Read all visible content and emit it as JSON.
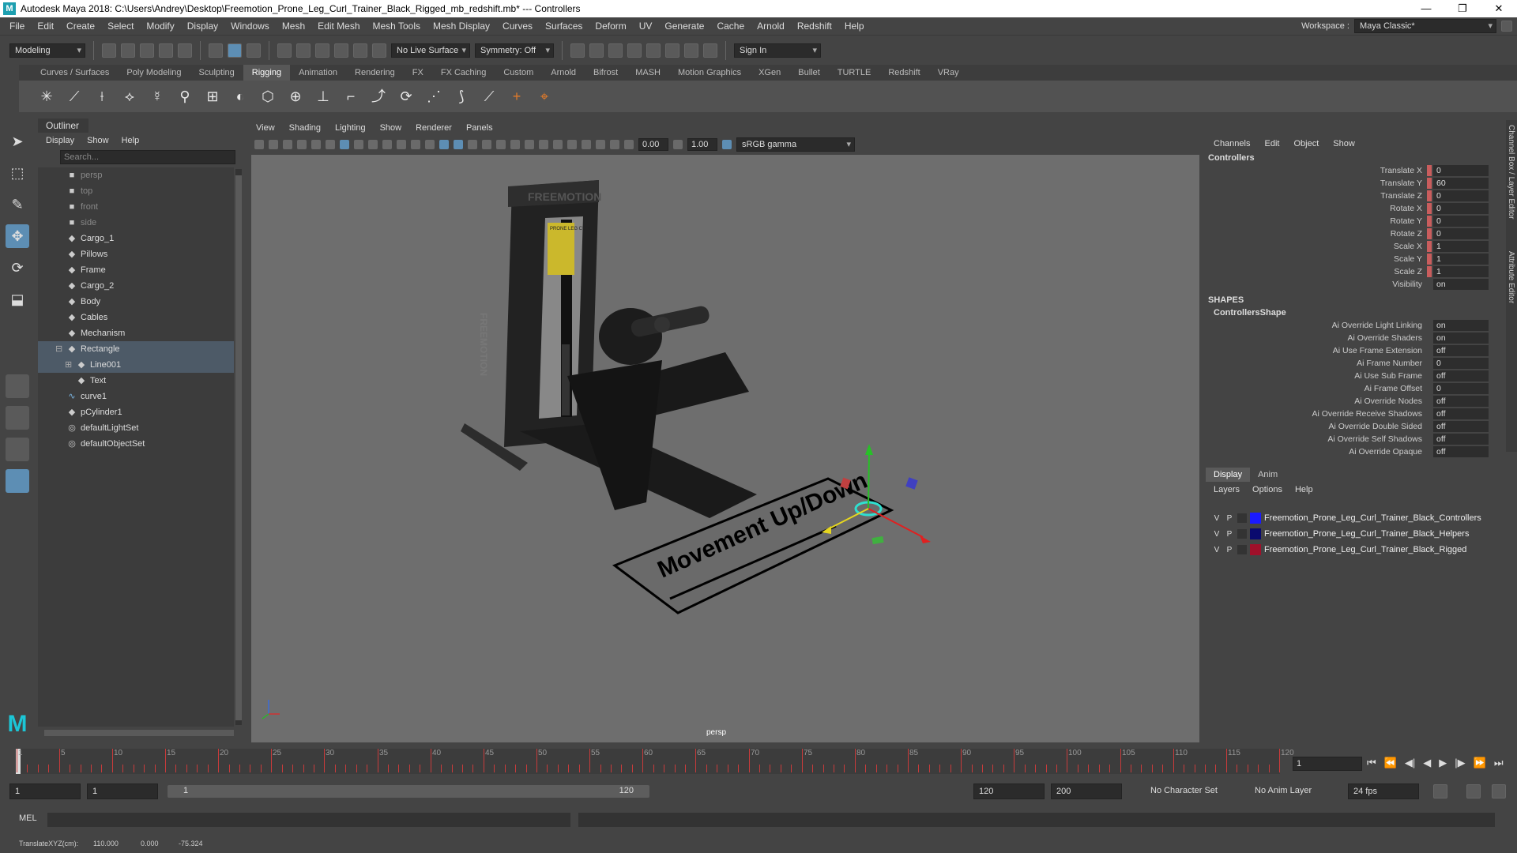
{
  "window": {
    "title": "Autodesk Maya 2018: C:\\Users\\Andrey\\Desktop\\Freemotion_Prone_Leg_Curl_Trainer_Black_Rigged_mb_redshift.mb*   ---   Controllers",
    "logo": "M",
    "min": "—",
    "max": "❐",
    "close": "✕"
  },
  "menu": [
    "File",
    "Edit",
    "Create",
    "Select",
    "Modify",
    "Display",
    "Windows",
    "Mesh",
    "Edit Mesh",
    "Mesh Tools",
    "Mesh Display",
    "Curves",
    "Surfaces",
    "Deform",
    "UV",
    "Generate",
    "Cache",
    "Arnold",
    "Redshift",
    "Help"
  ],
  "workspace": {
    "label": "Workspace :",
    "value": "Maya Classic*"
  },
  "statusline": {
    "mode": "Modeling",
    "live_surface": "No Live Surface",
    "symmetry": "Symmetry: Off",
    "sign_in": "Sign In"
  },
  "shelf_tabs": [
    "Curves / Surfaces",
    "Poly Modeling",
    "Sculpting",
    "Rigging",
    "Animation",
    "Rendering",
    "FX",
    "FX Caching",
    "Custom",
    "Arnold",
    "Bifrost",
    "MASH",
    "Motion Graphics",
    "XGen",
    "Bullet",
    "TURTLE",
    "Redshift",
    "VRay"
  ],
  "shelf_active": "Rigging",
  "shelf_icons": [
    "✳",
    "⟋",
    "⟊",
    "⟡",
    "☿",
    "⚲",
    "⊞",
    "◐",
    "⬡",
    "⊕",
    "⊥",
    "⌐",
    "⤴",
    "⟳",
    "⋰",
    "⟆",
    "⟋",
    "+",
    "⌖"
  ],
  "toolbox": [
    "➤",
    "⬚",
    "✎",
    "✥",
    "⟳",
    "⬓"
  ],
  "outliner": {
    "title": "Outliner",
    "menu": [
      "Display",
      "Show",
      "Help"
    ],
    "search_placeholder": "Search...",
    "items": [
      {
        "label": "persp",
        "icon": "■",
        "dim": true
      },
      {
        "label": "top",
        "icon": "■",
        "dim": true
      },
      {
        "label": "front",
        "icon": "■",
        "dim": true
      },
      {
        "label": "side",
        "icon": "■",
        "dim": true
      },
      {
        "label": "Cargo_1",
        "icon": "◆"
      },
      {
        "label": "Pillows",
        "icon": "◆"
      },
      {
        "label": "Frame",
        "icon": "◆"
      },
      {
        "label": "Cargo_2",
        "icon": "◆"
      },
      {
        "label": "Body",
        "icon": "◆"
      },
      {
        "label": "Cables",
        "icon": "◆"
      },
      {
        "label": "Mechanism",
        "icon": "◆"
      },
      {
        "label": "Rectangle",
        "icon": "◆",
        "selected": true,
        "expander": "⊟"
      },
      {
        "label": "Line001",
        "icon": "◆",
        "selected": true,
        "child": true,
        "expander": "⊞"
      },
      {
        "label": "Text",
        "icon": "◆",
        "child": true
      },
      {
        "label": "curve1",
        "icon": "∿"
      },
      {
        "label": "pCylinder1",
        "icon": "◆"
      },
      {
        "label": "defaultLightSet",
        "icon": "◎"
      },
      {
        "label": "defaultObjectSet",
        "icon": "◎"
      }
    ]
  },
  "viewport": {
    "menu": [
      "View",
      "Shading",
      "Lighting",
      "Show",
      "Renderer",
      "Panels"
    ],
    "exposure": "0.00",
    "gamma": "1.00",
    "color_space": "sRGB gamma",
    "camera": "persp",
    "machine_brand": "FREEMOTION",
    "placard": "PRONE LEG CURL",
    "control_text": "Movement Up/Down"
  },
  "channelbox": {
    "menu": [
      "Channels",
      "Edit",
      "Object",
      "Show"
    ],
    "object": "Controllers",
    "channels": [
      {
        "label": "Translate X",
        "value": "0"
      },
      {
        "label": "Translate Y",
        "value": "60"
      },
      {
        "label": "Translate Z",
        "value": "0"
      },
      {
        "label": "Rotate X",
        "value": "0"
      },
      {
        "label": "Rotate Y",
        "value": "0"
      },
      {
        "label": "Rotate Z",
        "value": "0"
      },
      {
        "label": "Scale X",
        "value": "1"
      },
      {
        "label": "Scale Y",
        "value": "1"
      },
      {
        "label": "Scale Z",
        "value": "1"
      },
      {
        "label": "Visibility",
        "value": "on",
        "nobar": true
      }
    ],
    "shapes_header": "SHAPES",
    "shape_name": "ControllersShape",
    "shape_attrs": [
      {
        "label": "Ai Override Light Linking",
        "value": "on"
      },
      {
        "label": "Ai Override Shaders",
        "value": "on"
      },
      {
        "label": "Ai Use Frame Extension",
        "value": "off"
      },
      {
        "label": "Ai Frame Number",
        "value": "0"
      },
      {
        "label": "Ai Use Sub Frame",
        "value": "off"
      },
      {
        "label": "Ai Frame Offset",
        "value": "0"
      },
      {
        "label": "Ai Override Nodes",
        "value": "off"
      },
      {
        "label": "Ai Override Receive Shadows",
        "value": "off"
      },
      {
        "label": "Ai Override Double Sided",
        "value": "off"
      },
      {
        "label": "Ai Override Self Shadows",
        "value": "off"
      },
      {
        "label": "Ai Override Opaque",
        "value": "off"
      }
    ],
    "side_tabs": [
      "Channel Box / Layer Editor",
      "Attribute Editor"
    ]
  },
  "layers": {
    "tabs": [
      "Display",
      "Anim"
    ],
    "menu": [
      "Layers",
      "Options",
      "Help"
    ],
    "rows": [
      {
        "v": "V",
        "p": "P",
        "name": "Freemotion_Prone_Leg_Curl_Trainer_Black_Controllers",
        "color": "#1a1aff"
      },
      {
        "v": "V",
        "p": "P",
        "name": "Freemotion_Prone_Leg_Curl_Trainer_Black_Helpers",
        "color": "#0a0a6e"
      },
      {
        "v": "V",
        "p": "P",
        "name": "Freemotion_Prone_Leg_Curl_Trainer_Black_Rigged",
        "color": "#a0102a"
      }
    ]
  },
  "timeslider": {
    "ticks": [
      "1",
      "5",
      "10",
      "15",
      "20",
      "25",
      "30",
      "35",
      "40",
      "45",
      "50",
      "55",
      "60",
      "65",
      "70",
      "75",
      "80",
      "85",
      "90",
      "95",
      "100",
      "105",
      "110",
      "115",
      "120"
    ],
    "end": 120,
    "current_frame": "1",
    "play_buttons": [
      "⏮",
      "⏪",
      "◀|",
      "◀",
      "▶",
      "|▶",
      "⏩",
      "⏭"
    ]
  },
  "range": {
    "start": "1",
    "playback_start": "1",
    "slider_start": "1",
    "slider_end": "120",
    "playback_end": "120",
    "end": "200",
    "character_set": "No Character Set",
    "anim_layer": "No Anim Layer",
    "fps": "24 fps"
  },
  "mel": {
    "label": "MEL"
  },
  "help": {
    "label": "TranslateXYZ(cm):",
    "x": "110.000",
    "y": "0.000",
    "z": "-75.324"
  }
}
